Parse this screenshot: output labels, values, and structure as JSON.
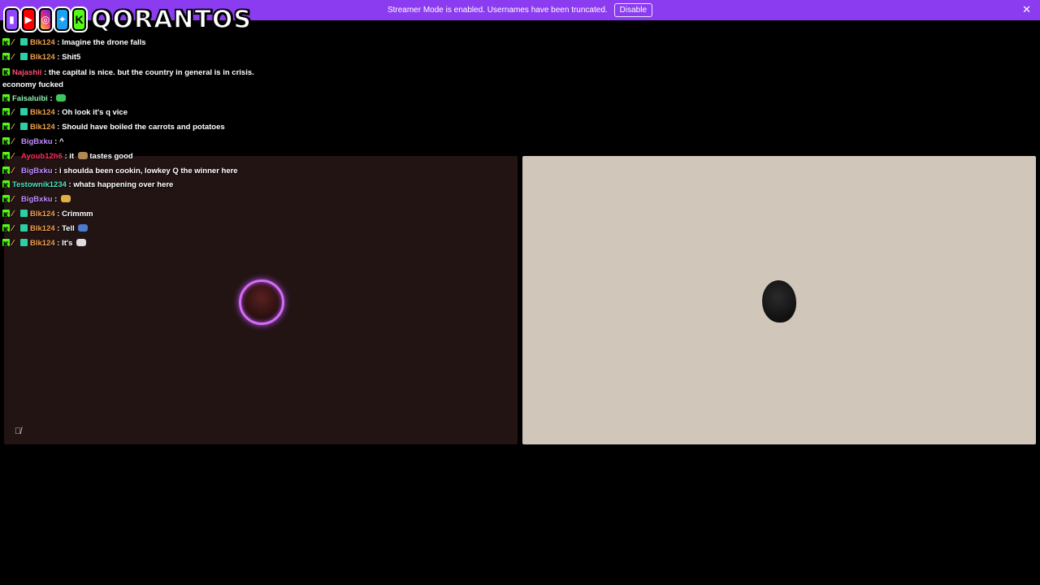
{
  "banner": {
    "message": "Streamer Mode is enabled. Usernames have been truncated.",
    "disable_label": "Disable",
    "close_icon": "close-icon",
    "color": "#8c3cf0"
  },
  "logo": {
    "brand": "QORANTOS",
    "socials": [
      "twitch-icon",
      "youtube-icon",
      "instagram-icon",
      "twitter-icon",
      "kick-icon"
    ]
  },
  "chat": [
    {
      "user": "Blk124",
      "color": "#f0a04b",
      "badges": [
        "kick",
        "sword",
        "sub"
      ],
      "text": " : Imagine the drone falls"
    },
    {
      "user": "Blk124",
      "color": "#f0a04b",
      "badges": [
        "kick",
        "sword",
        "sub"
      ],
      "text": " : Shit5"
    },
    {
      "user": "Najashii",
      "color": "#ff4b6e",
      "badges": [
        "kick"
      ],
      "text": " : the capital is nice. but the country in general is in crisis. economy fucked"
    },
    {
      "user": "Faisaluibi",
      "color": "#8ef0b0",
      "badges": [
        "kick"
      ],
      "text": " : ",
      "emote": "#3cc85a"
    },
    {
      "user": "Blk124",
      "color": "#f0a04b",
      "badges": [
        "kick",
        "sword",
        "sub"
      ],
      "text": " : Oh look it's q vice"
    },
    {
      "user": "Blk124",
      "color": "#f0a04b",
      "badges": [
        "kick",
        "sword",
        "sub"
      ],
      "text": " : Should have boiled the carrots and potatoes"
    },
    {
      "user": "BigBxku",
      "color": "#c08cff",
      "badges": [
        "kick",
        "sword"
      ],
      "text": " : ^"
    },
    {
      "user": "Ayoub12h6",
      "color": "#ff2d55",
      "badges": [
        "kick",
        "sword"
      ],
      "text": " : it ",
      "emote": "#b08a55",
      "after": " tastes good"
    },
    {
      "user": "BigBxku",
      "color": "#c08cff",
      "badges": [
        "kick",
        "sword"
      ],
      "text": " : i shoulda been cookin, lowkey Q the winner here"
    },
    {
      "user": "Testownik1234",
      "color": "#4de2c0",
      "badges": [
        "kick"
      ],
      "text": " : whats happening over here"
    },
    {
      "user": "BigBxku",
      "color": "#c08cff",
      "badges": [
        "kick",
        "sword"
      ],
      "text": " : ",
      "emote": "#e0b040"
    },
    {
      "user": "Blk124",
      "color": "#f0a04b",
      "badges": [
        "kick",
        "sword",
        "sub"
      ],
      "text": " : Crimmm"
    },
    {
      "user": "Blk124",
      "color": "#f0a04b",
      "badges": [
        "kick",
        "sword",
        "sub"
      ],
      "text": " : Tell ",
      "emote": "#4a7bd0"
    },
    {
      "user": "Blk124",
      "color": "#f0a04b",
      "badges": [
        "kick",
        "sword",
        "sub"
      ],
      "text": " : It's ",
      "emote": "#ddd"
    }
  ],
  "tiles": {
    "left_bg": "#231414",
    "right_bg": "#d1c6ba",
    "mute_icon": "microphone-muted-icon"
  }
}
